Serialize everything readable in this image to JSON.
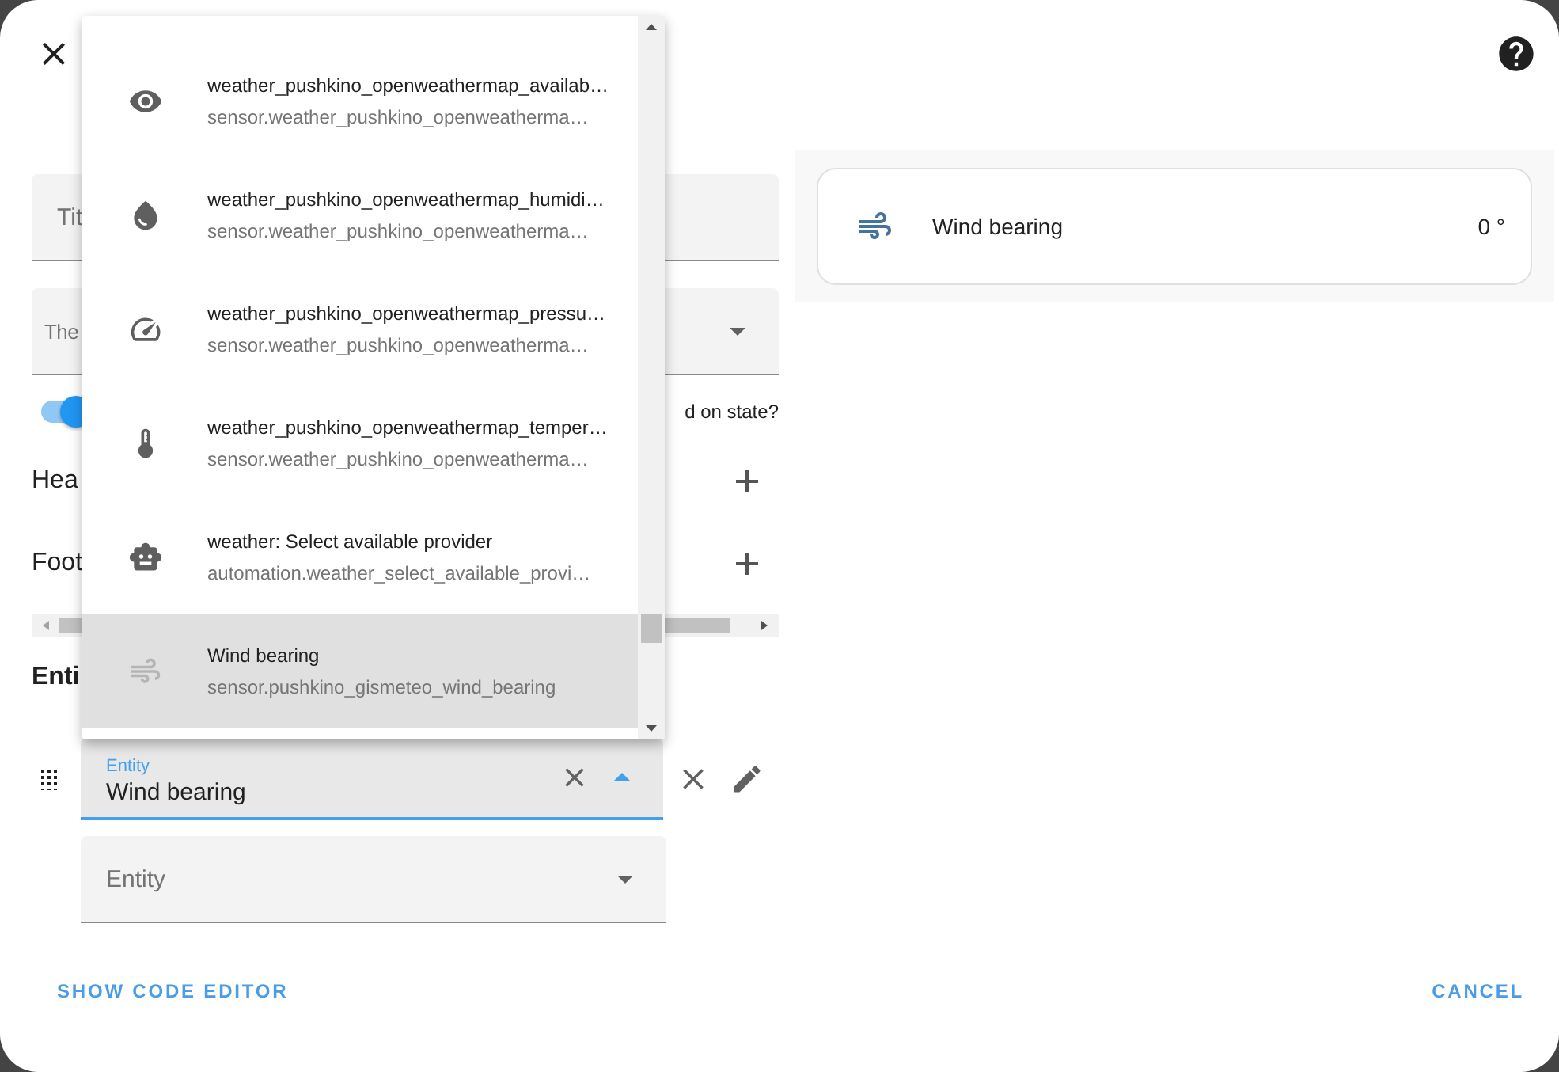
{
  "editor": {
    "title_field": {
      "label": "Tit"
    },
    "theme_select": {
      "label": "The"
    },
    "state_toggle": {
      "on": true,
      "label": "d on state?"
    },
    "header_row": {
      "label": "Hea"
    },
    "footer_row": {
      "label": "Foot"
    },
    "entities_heading": "Enti",
    "entity_rows": [
      {
        "label": "Entity",
        "value": "Wind bearing",
        "focused": true
      }
    ],
    "new_entity": {
      "placeholder": "Entity"
    }
  },
  "dropdown": {
    "items": [
      {
        "kind": "eye",
        "name": "weather_pushkino_openweathermap_availab…",
        "entity_id": "sensor.weather_pushkino_openweatherma…",
        "selected": false
      },
      {
        "kind": "drop",
        "name": "weather_pushkino_openweathermap_humidi…",
        "entity_id": "sensor.weather_pushkino_openweatherma…",
        "selected": false
      },
      {
        "kind": "gauge",
        "name": "weather_pushkino_openweathermap_pressu…",
        "entity_id": "sensor.weather_pushkino_openweatherma…",
        "selected": false
      },
      {
        "kind": "thermometer",
        "name": "weather_pushkino_openweathermap_temper…",
        "entity_id": "sensor.weather_pushkino_openweatherma…",
        "selected": false
      },
      {
        "kind": "robot",
        "name": "weather: Select available provider",
        "entity_id": "automation.weather_select_available_provi…",
        "selected": false
      },
      {
        "kind": "wind",
        "name": "Wind bearing",
        "entity_id": "sensor.pushkino_gismeteo_wind_bearing",
        "selected": true
      }
    ]
  },
  "preview": {
    "name": "Wind bearing",
    "value": "0 °"
  },
  "buttons": [
    {
      "label": "SHOW CODE EDITOR"
    },
    {
      "label": "CANCEL"
    }
  ]
}
